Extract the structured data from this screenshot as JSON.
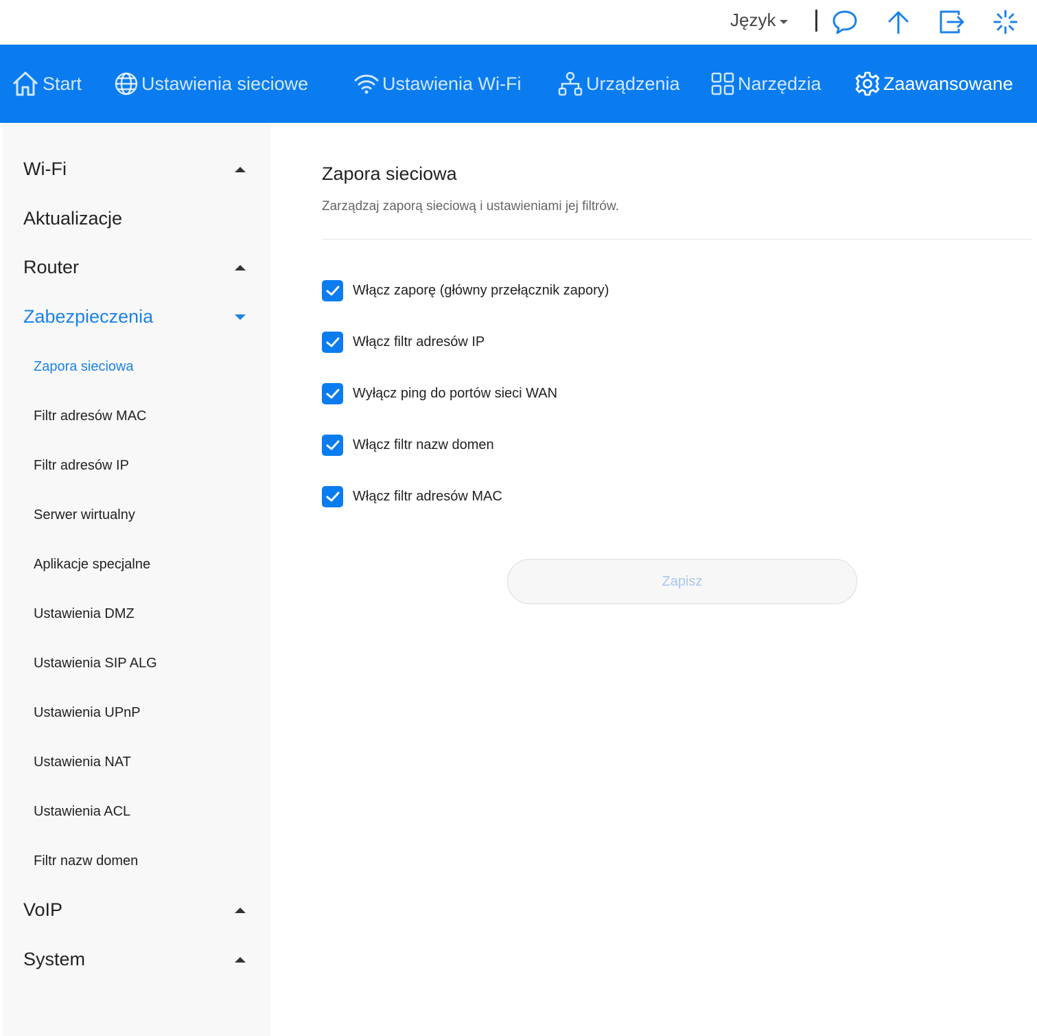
{
  "topbar": {
    "language_label": "Język",
    "icons": [
      "chat-icon",
      "upload-arrow-icon",
      "logout-icon",
      "loading-icon"
    ]
  },
  "nav": {
    "items": [
      {
        "label": "Start",
        "icon": "home-icon"
      },
      {
        "label": "Ustawienia sieciowe",
        "icon": "globe-icon"
      },
      {
        "label": "Ustawienia Wi-Fi",
        "icon": "wifi-icon"
      },
      {
        "label": "Urządzenia",
        "icon": "devices-icon"
      },
      {
        "label": "Narzędzia",
        "icon": "tools-grid-icon"
      },
      {
        "label": "Zaawansowane",
        "icon": "gear-icon",
        "active": true
      }
    ]
  },
  "sidebar": {
    "groups": [
      {
        "label": "Wi-Fi",
        "expanded": false
      },
      {
        "label": "Aktualizacje"
      },
      {
        "label": "Router",
        "expanded": false
      },
      {
        "label": "Zabezpieczenia",
        "expanded": true,
        "active": true
      },
      {
        "label": "VoIP",
        "expanded": false
      },
      {
        "label": "System",
        "expanded": false
      }
    ],
    "security_items": [
      {
        "label": "Zapora sieciowa",
        "active": true
      },
      {
        "label": "Filtr adresów MAC"
      },
      {
        "label": "Filtr adresów IP"
      },
      {
        "label": "Serwer wirtualny"
      },
      {
        "label": "Aplikacje specjalne"
      },
      {
        "label": "Ustawienia DMZ"
      },
      {
        "label": "Ustawienia SIP ALG"
      },
      {
        "label": "Ustawienia UPnP"
      },
      {
        "label": "Ustawienia NAT"
      },
      {
        "label": "Ustawienia ACL"
      },
      {
        "label": "Filtr nazw domen"
      }
    ]
  },
  "content": {
    "title": "Zapora sieciowa",
    "description": "Zarządzaj zaporą sieciową i ustawieniami jej filtrów.",
    "options": [
      {
        "label": "Włącz zaporę (główny przełącznik zapory)",
        "checked": true
      },
      {
        "label": "Włącz filtr adresów IP",
        "checked": true
      },
      {
        "label": "Wyłącz ping do portów sieci WAN",
        "checked": true
      },
      {
        "label": "Włącz filtr nazw domen",
        "checked": true
      },
      {
        "label": "Włącz filtr adresów MAC",
        "checked": true
      }
    ],
    "save_label": "Zapisz"
  },
  "colors": {
    "primary": "#0a7cf0",
    "active_text": "#1a82e8",
    "sidebar_bg": "#f8f8f8",
    "save_text_disabled": "#a8c8ef"
  }
}
